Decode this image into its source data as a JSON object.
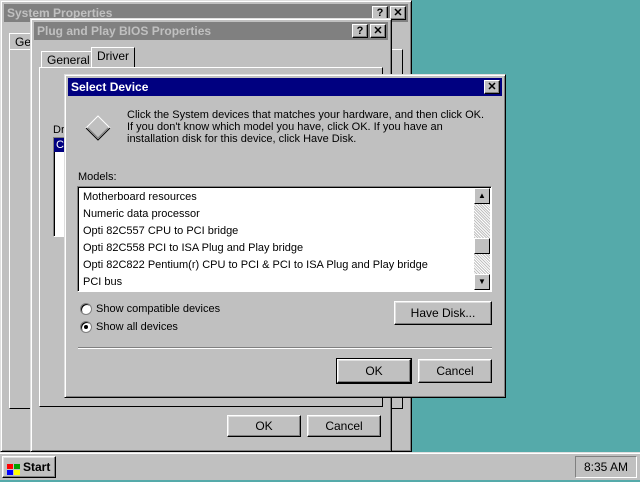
{
  "system_properties": {
    "title": "System Properties",
    "tab_partial": "Ge"
  },
  "pnp_bios": {
    "title": "Plug and Play BIOS Properties",
    "tabs": [
      "General",
      "Driver"
    ],
    "driver_label_partial": "Dr",
    "list_partial": "C",
    "ok_label": "OK",
    "cancel_label": "Cancel"
  },
  "title_buttons": {
    "help": "?",
    "close": "✕"
  },
  "select_device": {
    "title": "Select Device",
    "instructions": "Click the System devices that matches your hardware, and then click OK. If you don't know which model you have, click OK. If you have an installation disk for this device, click Have Disk.",
    "models_label": "Models:",
    "models": [
      "Motherboard resources",
      "Numeric data processor",
      "Opti 82C557 CPU to PCI bridge",
      "Opti 82C558 PCI to ISA Plug and Play bridge",
      "Opti 82C822 Pentium(r) CPU to PCI & PCI to ISA Plug and Play bridge",
      "PCI bus"
    ],
    "show_compatible": "Show compatible devices",
    "show_all": "Show all devices",
    "selected_option": "show_all",
    "have_disk_label": "Have Disk...",
    "ok_label": "OK",
    "cancel_label": "Cancel"
  },
  "taskbar": {
    "start_label": "Start",
    "clock": "8:35 AM"
  }
}
